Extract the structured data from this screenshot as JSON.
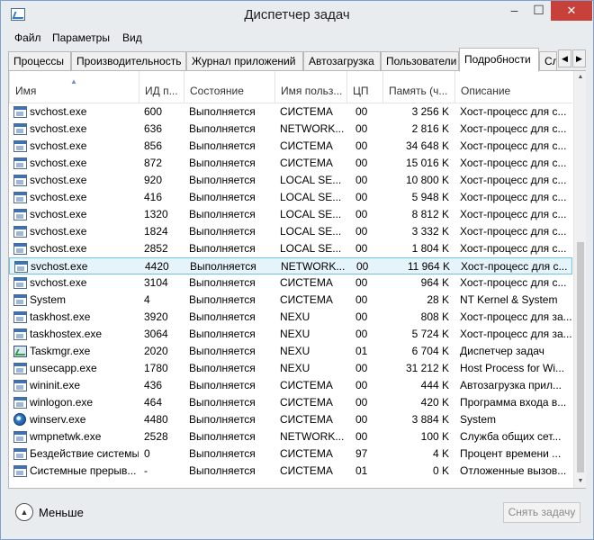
{
  "window": {
    "title": "Диспетчер задач",
    "minimize_glyph": "–",
    "maximize_glyph": "☐",
    "close_glyph": "✕"
  },
  "menu": [
    "Файл",
    "Параметры",
    "Вид"
  ],
  "tabs": [
    "Процессы",
    "Производительность",
    "Журнал приложений",
    "Автозагрузка",
    "Пользователи",
    "Подробности",
    "Службы"
  ],
  "active_tab": "Подробности",
  "table": {
    "columns": [
      "Имя",
      "ИД п...",
      "Состояние",
      "Имя польз...",
      "ЦП",
      "Память (ч...",
      "Описание"
    ],
    "sorted_by": "Имя",
    "rows": [
      {
        "icon": "exe-icon",
        "name": "svchost.exe",
        "pid": "600",
        "status": "Выполняется",
        "user": "СИСТЕМА",
        "cpu": "00",
        "memory": "3 256 K",
        "desc": "Хост-процесс для с..."
      },
      {
        "icon": "exe-icon",
        "name": "svchost.exe",
        "pid": "636",
        "status": "Выполняется",
        "user": "NETWORK...",
        "cpu": "00",
        "memory": "2 816 K",
        "desc": "Хост-процесс для с..."
      },
      {
        "icon": "exe-icon",
        "name": "svchost.exe",
        "pid": "856",
        "status": "Выполняется",
        "user": "СИСТЕМА",
        "cpu": "00",
        "memory": "34 648 K",
        "desc": "Хост-процесс для с..."
      },
      {
        "icon": "exe-icon",
        "name": "svchost.exe",
        "pid": "872",
        "status": "Выполняется",
        "user": "СИСТЕМА",
        "cpu": "00",
        "memory": "15 016 K",
        "desc": "Хост-процесс для с..."
      },
      {
        "icon": "exe-icon",
        "name": "svchost.exe",
        "pid": "920",
        "status": "Выполняется",
        "user": "LOCAL SE...",
        "cpu": "00",
        "memory": "10 800 K",
        "desc": "Хост-процесс для с..."
      },
      {
        "icon": "exe-icon",
        "name": "svchost.exe",
        "pid": "416",
        "status": "Выполняется",
        "user": "LOCAL SE...",
        "cpu": "00",
        "memory": "5 948 K",
        "desc": "Хост-процесс для с..."
      },
      {
        "icon": "exe-icon",
        "name": "svchost.exe",
        "pid": "1320",
        "status": "Выполняется",
        "user": "LOCAL SE...",
        "cpu": "00",
        "memory": "8 812 K",
        "desc": "Хост-процесс для с..."
      },
      {
        "icon": "exe-icon",
        "name": "svchost.exe",
        "pid": "1824",
        "status": "Выполняется",
        "user": "LOCAL SE...",
        "cpu": "00",
        "memory": "3 332 K",
        "desc": "Хост-процесс для с..."
      },
      {
        "icon": "exe-icon",
        "name": "svchost.exe",
        "pid": "2852",
        "status": "Выполняется",
        "user": "LOCAL SE...",
        "cpu": "00",
        "memory": "1 804 K",
        "desc": "Хост-процесс для с..."
      },
      {
        "icon": "exe-icon",
        "name": "svchost.exe",
        "pid": "4420",
        "status": "Выполняется",
        "user": "NETWORK...",
        "cpu": "00",
        "memory": "11 964 K",
        "desc": "Хост-процесс для с...",
        "selected": true
      },
      {
        "icon": "exe-icon",
        "name": "svchost.exe",
        "pid": "3104",
        "status": "Выполняется",
        "user": "СИСТЕМА",
        "cpu": "00",
        "memory": "964 K",
        "desc": "Хост-процесс для с..."
      },
      {
        "icon": "exe-icon",
        "name": "System",
        "pid": "4",
        "status": "Выполняется",
        "user": "СИСТЕМА",
        "cpu": "00",
        "memory": "28 K",
        "desc": "NT Kernel & System"
      },
      {
        "icon": "exe-icon",
        "name": "taskhost.exe",
        "pid": "3920",
        "status": "Выполняется",
        "user": "NEXU",
        "cpu": "00",
        "memory": "808 K",
        "desc": "Хост-процесс для за..."
      },
      {
        "icon": "exe-icon",
        "name": "taskhostex.exe",
        "pid": "3064",
        "status": "Выполняется",
        "user": "NEXU",
        "cpu": "00",
        "memory": "5 724 K",
        "desc": "Хост-процесс для за..."
      },
      {
        "icon": "taskmgr-icon",
        "name": "Taskmgr.exe",
        "pid": "2020",
        "status": "Выполняется",
        "user": "NEXU",
        "cpu": "01",
        "memory": "6 704 K",
        "desc": "Диспетчер задач"
      },
      {
        "icon": "exe-icon",
        "name": "unsecapp.exe",
        "pid": "1780",
        "status": "Выполняется",
        "user": "NEXU",
        "cpu": "00",
        "memory": "31 212 K",
        "desc": "Host Process for Wi..."
      },
      {
        "icon": "exe-icon",
        "name": "wininit.exe",
        "pid": "436",
        "status": "Выполняется",
        "user": "СИСТЕМА",
        "cpu": "00",
        "memory": "444 K",
        "desc": "Автозагрузка прил..."
      },
      {
        "icon": "exe-icon",
        "name": "winlogon.exe",
        "pid": "464",
        "status": "Выполняется",
        "user": "СИСТЕМА",
        "cpu": "00",
        "memory": "420 K",
        "desc": "Программа входа в..."
      },
      {
        "icon": "globe-icon",
        "name": "winserv.exe",
        "pid": "4480",
        "status": "Выполняется",
        "user": "СИСТЕМА",
        "cpu": "00",
        "memory": "3 884 K",
        "desc": "System"
      },
      {
        "icon": "exe-icon",
        "name": "wmpnetwk.exe",
        "pid": "2528",
        "status": "Выполняется",
        "user": "NETWORK...",
        "cpu": "00",
        "memory": "100 K",
        "desc": "Служба общих сет..."
      },
      {
        "icon": "exe-icon",
        "name": "Бездействие системы",
        "pid": "0",
        "status": "Выполняется",
        "user": "СИСТЕМА",
        "cpu": "97",
        "memory": "4 K",
        "desc": "Процент времени ..."
      },
      {
        "icon": "exe-icon",
        "name": "Системные прерыв...",
        "pid": "-",
        "status": "Выполняется",
        "user": "СИСТЕМА",
        "cpu": "01",
        "memory": "0 K",
        "desc": "Отложенные вызов..."
      }
    ]
  },
  "footer": {
    "less_label": "Меньше",
    "end_task_label": "Снять задачу"
  }
}
